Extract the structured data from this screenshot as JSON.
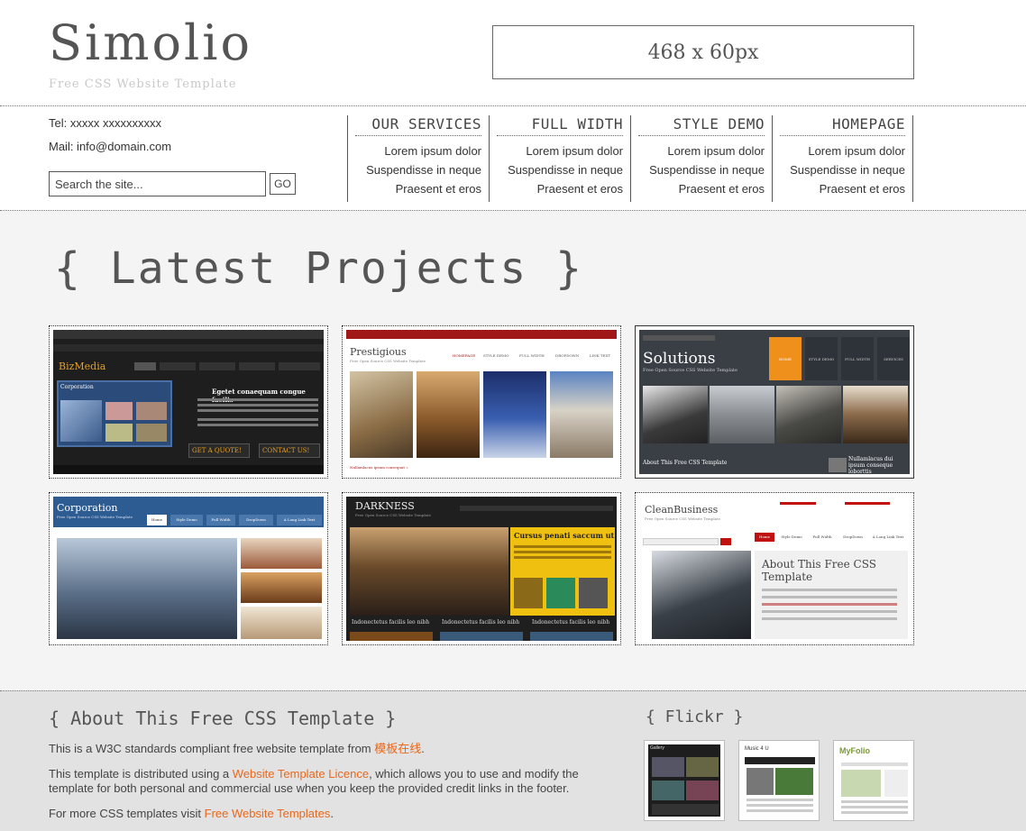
{
  "header": {
    "logo": "Simolio",
    "tagline": "Free CSS Website Template",
    "banner": "468 x 60px"
  },
  "contact": {
    "tel": "Tel: xxxxx xxxxxxxxxx",
    "mail": "Mail: info@domain.com"
  },
  "search": {
    "placeholder": "Search the site...",
    "button": "GO"
  },
  "nav": [
    {
      "title": "OUR SERVICES",
      "links": [
        "Lorem ipsum dolor",
        "Suspendisse in neque",
        "Praesent et eros"
      ]
    },
    {
      "title": "FULL WIDTH",
      "links": [
        "Lorem ipsum dolor",
        "Suspendisse in neque",
        "Praesent et eros"
      ]
    },
    {
      "title": "STYLE DEMO",
      "links": [
        "Lorem ipsum dolor",
        "Suspendisse in neque",
        "Praesent et eros"
      ]
    },
    {
      "title": "HOMEPAGE",
      "links": [
        "Lorem ipsum dolor",
        "Suspendisse in neque",
        "Praesent et eros"
      ]
    }
  ],
  "projects": {
    "title": "{ Latest Projects }",
    "items": [
      {
        "name": "BizMedia",
        "heading": "Egetet conaequam congue facilis",
        "btn1": "GET A QUOTE!",
        "btn2": "CONTACT US!",
        "box": "Corporation"
      },
      {
        "name": "Prestigious",
        "sub": "Free Open Source CSS Website Template",
        "menu": [
          "HOMEPAGE",
          "STYLE DEMO",
          "FULL WIDTH",
          "DROPDOWN",
          "LINK TEXT"
        ],
        "caption": "Nullamlacus ipsum consequat »"
      },
      {
        "name": "Solutions",
        "sub": "Free Open Source CSS Website Template",
        "menu": [
          "HOME",
          "STYLE DEMO",
          "FULL WIDTH",
          "SERVICES"
        ],
        "caption": "About This Free CSS Template",
        "side": "Nullamlacus dui ipsum conseque loborttis"
      },
      {
        "name": "Corporation",
        "sub": "Free Open Source CSS Website Template",
        "menu": [
          "Home",
          "Style Demo",
          "Full Width",
          "DropDown",
          "A Long Link Text"
        ]
      },
      {
        "name": "DARKNESS",
        "sub": "Free Open Source CSS Website Template",
        "heading": "Cursus penati saccum ut.",
        "captions": [
          "Indonectetus facilis leo nibh",
          "Indonectetus facilis leo nibh",
          "Indonectetus facilis leo nibh"
        ]
      },
      {
        "name": "CleanBusiness",
        "sub": "Free Open Source CSS Website Template",
        "heading": "About This Free CSS Template",
        "menu": [
          "Home",
          "Style Demo",
          "Full Width",
          "DropDown",
          "A Long Link Text"
        ]
      }
    ]
  },
  "footer": {
    "about_title": "{ About This Free CSS Template }",
    "p1_pre": "This is a W3C standards compliant free website template from ",
    "p1_link": "模板在线",
    "p1_post": ".",
    "p2_pre": "This template is distributed using a ",
    "p2_link": "Website Template Licence",
    "p2_post": ", which allows you to use and modify the template for both personal and commercial use when you keep the provided credit links in the footer.",
    "p3_pre": "For more CSS templates visit ",
    "p3_link": "Free Website Templates",
    "p3_post": ".",
    "flickr_title": "{ Flickr }",
    "flickr_labels": [
      "Gallery",
      "Music 4 U",
      "MyFolio"
    ]
  },
  "colors": {
    "link_accent": "#e8681c",
    "page_bg": "#f4f4f4",
    "footer_bg": "#e2e2e2"
  }
}
